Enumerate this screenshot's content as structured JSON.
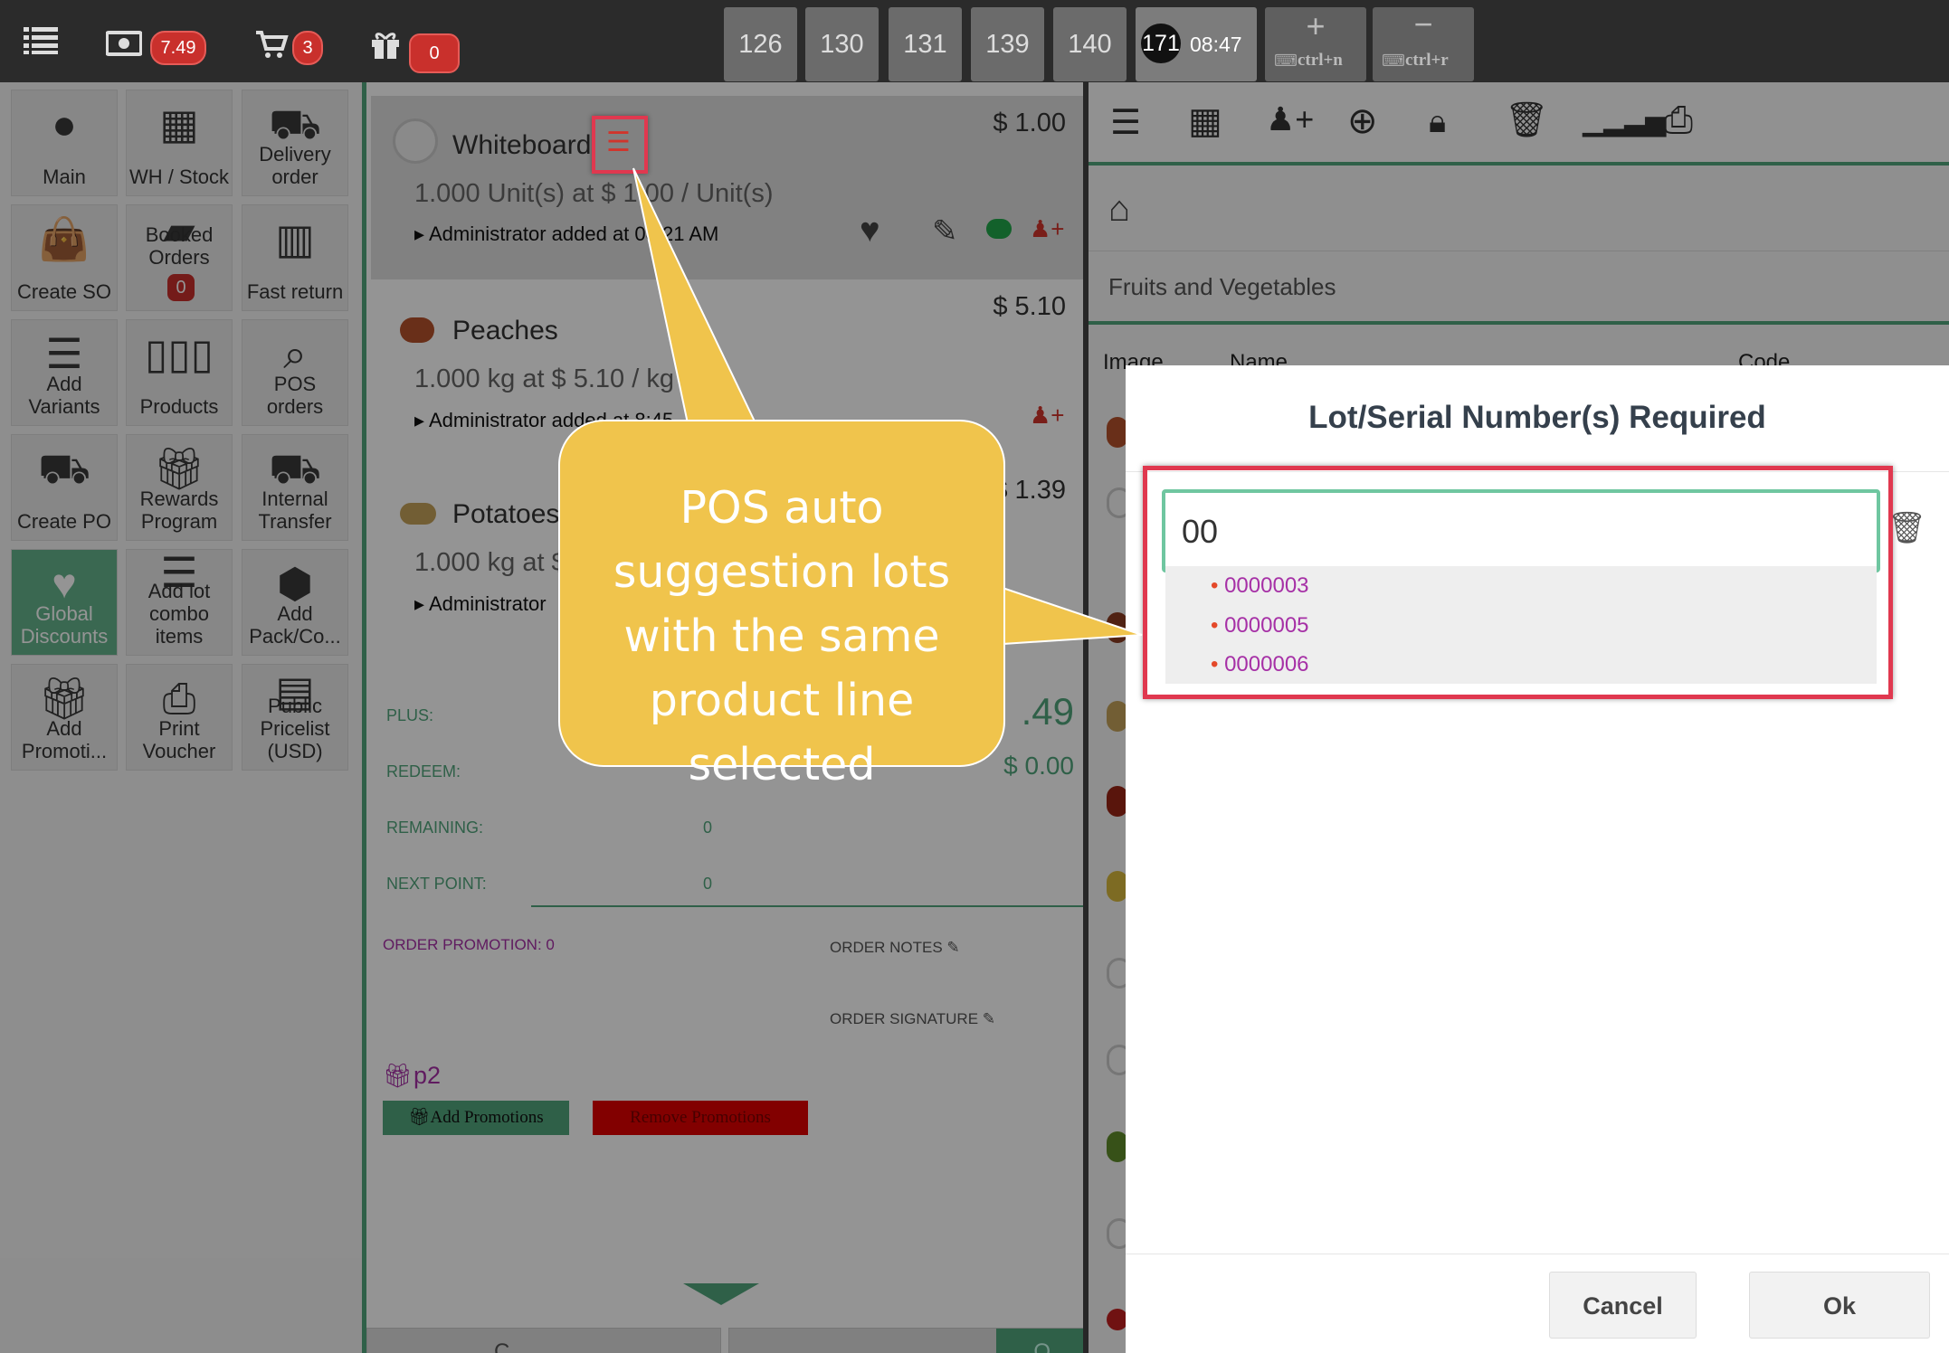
{
  "topbar": {
    "menu_icon": "list-icon",
    "cash_badge": "7.49",
    "cart_badge": "3",
    "gift_badge": "0",
    "order_tabs": [
      "126",
      "130",
      "131",
      "139",
      "140"
    ],
    "active_order": {
      "number": "171",
      "time": "08:47"
    },
    "new_order_shortcut": "ctrl+n",
    "remove_order_shortcut": "ctrl+r"
  },
  "sidebar": {
    "buttons": [
      {
        "label": "Main",
        "icon": "user-icon"
      },
      {
        "label": "WH / Stock",
        "icon": "grid-icon"
      },
      {
        "label": "Delivery order",
        "icon": "truck-icon"
      },
      {
        "label": "Create SO",
        "icon": "shopping-bag-icon"
      },
      {
        "label": "Booked Orders",
        "icon": "book-icon",
        "badge": "0"
      },
      {
        "label": "Fast return",
        "icon": "building-icon"
      },
      {
        "label": "Add Variants",
        "icon": "sliders-icon"
      },
      {
        "label": "Products",
        "icon": "barcode-icon"
      },
      {
        "label": "POS orders",
        "icon": "search-icon"
      },
      {
        "label": "Create PO",
        "icon": "truck-icon"
      },
      {
        "label": "Rewards Program",
        "icon": "gift-icon"
      },
      {
        "label": "Internal Transfer",
        "icon": "truck-icon"
      },
      {
        "label": "Global Discounts",
        "icon": "heart-icon"
      },
      {
        "label": "Add lot combo items",
        "icon": "sliders-icon"
      },
      {
        "label": "Add Pack/Co...",
        "icon": "cubes-icon"
      },
      {
        "label": "Add Promoti...",
        "icon": "gift-icon"
      },
      {
        "label": "Print Voucher",
        "icon": "print-icon"
      },
      {
        "label": "Public Pricelist (USD)",
        "icon": "table-icon"
      }
    ]
  },
  "order": {
    "lines": [
      {
        "name": "Whiteboard",
        "price": "$ 1.00",
        "qty": "1.000 Unit(s) at $ 1.00 / Unit(s)",
        "added": "Administrator added at 08:21 AM"
      },
      {
        "name": "Peaches",
        "price": "$ 5.10",
        "qty": "1.000 kg at $ 5.10 / kg",
        "added": "Administrator added at 8:45"
      },
      {
        "name": "Potatoes",
        "price": "$ 1.39",
        "qty": "1.000 kg at $",
        "added": "Administrator"
      }
    ],
    "points": [
      {
        "label": "PLUS:",
        "value": ""
      },
      {
        "label": "REDEEM:",
        "value": ""
      },
      {
        "label": "REMAINING:",
        "value": "0"
      },
      {
        "label": "NEXT POINT:",
        "value": "0"
      }
    ],
    "total_fragment": ".49",
    "discount_fragment": "$ 0.00",
    "order_promotion": "ORDER PROMOTION: 0",
    "order_notes": "ORDER NOTES",
    "order_signature": "ORDER SIGNATURE",
    "promotion_name": "p2",
    "add_promotions": "Add Promotions",
    "remove_promotions": "Remove Promotions",
    "bottom_left_fragment": "C",
    "bottom_right_fragment": "O"
  },
  "right": {
    "breadcrumb_home": "home-icon",
    "category": "Fruits and Vegetables",
    "columns": [
      "Image",
      "Name",
      "Code"
    ]
  },
  "modal": {
    "title": "Lot/Serial Number(s) Required",
    "input_value": "00",
    "suggestions": [
      "0000003",
      "0000005",
      "0000006"
    ],
    "cancel": "Cancel",
    "ok": "Ok"
  },
  "callout": {
    "text": "POS auto suggestion lots with the same product line selected"
  },
  "colors": {
    "highlight_red": "#e0384f",
    "callout_yellow": "#f0c44c",
    "accent_green": "#52a57c",
    "suggestion_purple": "#a630a6"
  }
}
